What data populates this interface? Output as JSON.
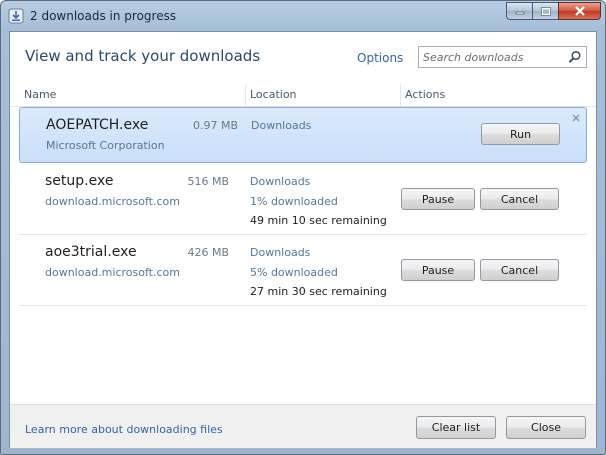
{
  "window": {
    "title": "2 downloads in progress"
  },
  "header": {
    "title": "View and track your downloads",
    "options_label": "Options",
    "search_placeholder": "Search downloads"
  },
  "columns": {
    "name": "Name",
    "location": "Location",
    "actions": "Actions"
  },
  "downloads": [
    {
      "name": "AOEPATCH.exe",
      "publisher": "Microsoft Corporation",
      "size": "0.97 MB",
      "location": "Downloads",
      "status": "",
      "remaining": "",
      "selected": true,
      "run_label": "Run"
    },
    {
      "name": "setup.exe",
      "publisher": "download.microsoft.com",
      "size": "516 MB",
      "location": "Downloads",
      "status": "1% downloaded",
      "progress_percent": 1,
      "remaining": "49 min 10 sec remaining",
      "pause_label": "Pause",
      "cancel_label": "Cancel"
    },
    {
      "name": "aoe3trial.exe",
      "publisher": "download.microsoft.com",
      "size": "426 MB",
      "location": "Downloads",
      "status": "5% downloaded",
      "progress_percent": 5,
      "remaining": "27 min 30 sec remaining",
      "pause_label": "Pause",
      "cancel_label": "Cancel"
    }
  ],
  "footer": {
    "learn_more_label": "Learn more about downloading files",
    "clear_list_label": "Clear list",
    "close_label": "Close"
  },
  "icons": {
    "app": "download-manager-icon",
    "search": "search-icon",
    "dismiss": "close-icon",
    "minimize": "minimize-icon",
    "maximize": "maximize-icon",
    "close": "close-icon"
  },
  "colors": {
    "selection": "#c9dff8",
    "link": "#3465a4",
    "close_button": "#c13a20"
  }
}
